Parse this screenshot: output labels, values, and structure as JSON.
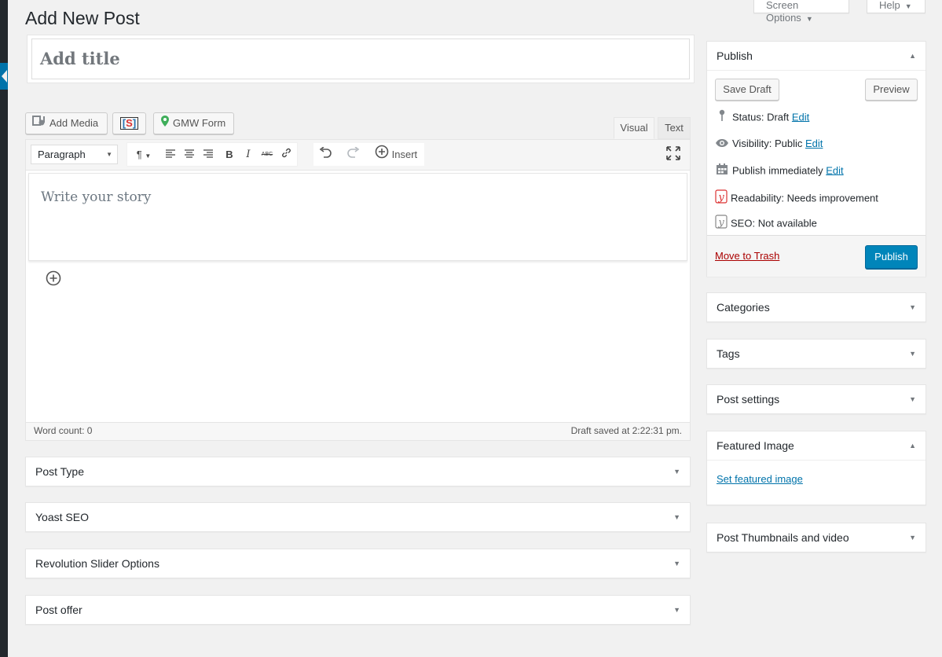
{
  "page_title": "Add New Post",
  "top_tabs": {
    "screen_options": "Screen Options",
    "help": "Help"
  },
  "title_field": {
    "placeholder": "Add title"
  },
  "media_buttons": {
    "add_media": "Add Media",
    "shortcode": "S",
    "gmw_form": "GMW Form"
  },
  "editor_tabs": {
    "visual": "Visual",
    "text": "Text"
  },
  "toolbar": {
    "format_select": "Paragraph",
    "insert": "Insert",
    "strikethrough": "ABC"
  },
  "editor": {
    "placeholder": "Write your story"
  },
  "status_bar": {
    "word_count": "Word count: 0",
    "draft_saved": "Draft saved at 2:22:31 pm."
  },
  "main_boxes": [
    "Post Type",
    "Yoast SEO",
    "Revolution Slider Options",
    "Post offer"
  ],
  "publish": {
    "title": "Publish",
    "save_draft": "Save Draft",
    "preview": "Preview",
    "status_label": "Status:",
    "status_value": "Draft",
    "visibility_label": "Visibility:",
    "visibility_value": "Public",
    "publish_label": "Publish",
    "publish_value": "immediately",
    "edit": "Edit",
    "readability_label": "Readability:",
    "readability_value": "Needs improvement",
    "seo_label": "SEO:",
    "seo_value": "Not available",
    "move_to_trash": "Move to Trash",
    "publish_button": "Publish"
  },
  "side_boxes": [
    "Categories",
    "Tags",
    "Post settings"
  ],
  "featured_image": {
    "title": "Featured Image",
    "link": "Set featured image"
  },
  "thumbnails_box": "Post Thumbnails and video",
  "colors": {
    "accent": "#0085ba",
    "link": "#0073aa",
    "trash": "#a00",
    "yoast_red": "#dc3232"
  }
}
